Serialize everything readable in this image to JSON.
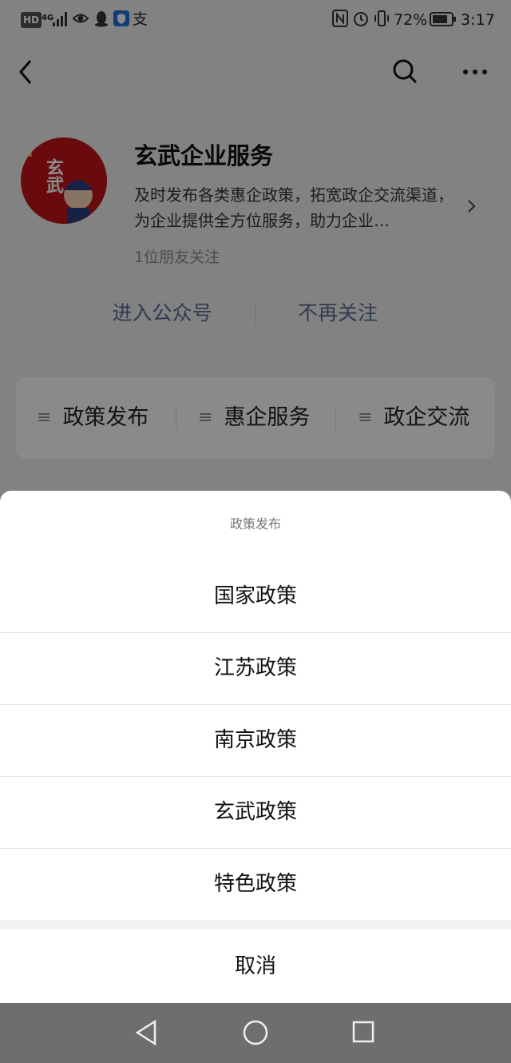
{
  "status_bar": {
    "hd": "HD",
    "network": "4G",
    "app_glyph": "支",
    "battery": "72%",
    "time": "3:17"
  },
  "account": {
    "name": "玄武企业服务",
    "description": "及时发布各类惠企政策，拓宽政企交流渠道，为企业提供全方位服务，助力企业…",
    "followers": "1位朋友关注",
    "avatar_text": "玄武"
  },
  "actions": {
    "enter": "进入公众号",
    "unfollow": "不再关注"
  },
  "menu": {
    "items": [
      {
        "label": "政策发布"
      },
      {
        "label": "惠企服务"
      },
      {
        "label": "政企交流"
      }
    ]
  },
  "sheet": {
    "title": "政策发布",
    "options": [
      {
        "label": "国家政策"
      },
      {
        "label": "江苏政策"
      },
      {
        "label": "南京政策"
      },
      {
        "label": "玄武政策"
      },
      {
        "label": "特色政策"
      }
    ],
    "cancel": "取消"
  },
  "colors": {
    "link": "#5a6b94",
    "avatar_bg": "#c0151b"
  }
}
